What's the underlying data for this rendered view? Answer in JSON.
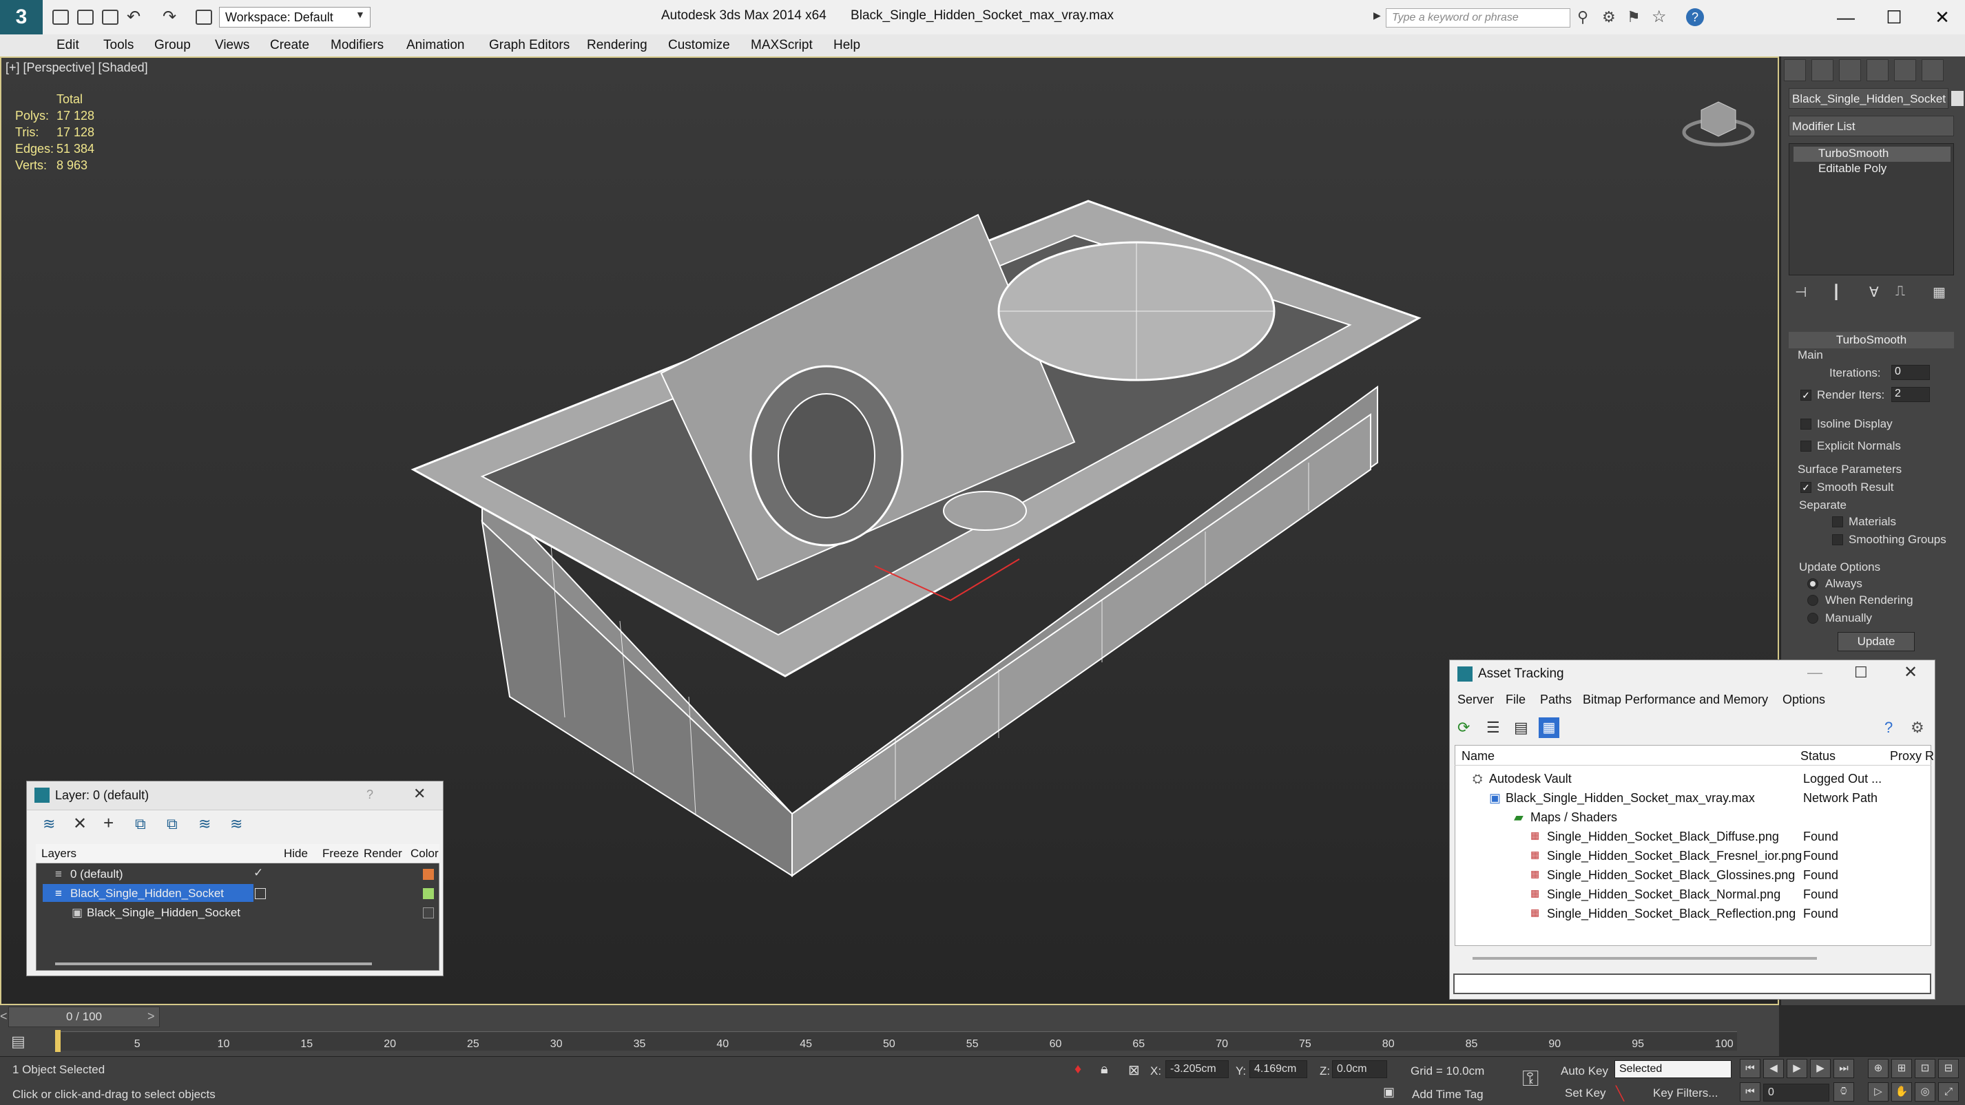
{
  "app": {
    "title": "Autodesk 3ds Max  2014 x64",
    "file_name": "Black_Single_Hidden_Socket_max_vray.max",
    "workspace": "Workspace: Default",
    "search_placeholder": "Type a keyword or phrase"
  },
  "menu": [
    "Edit",
    "Tools",
    "Group",
    "Views",
    "Create",
    "Modifiers",
    "Animation",
    "Graph Editors",
    "Rendering",
    "Customize",
    "MAXScript",
    "Help"
  ],
  "viewport": {
    "label": "[+] [Perspective] [Shaded]",
    "stats": {
      "header": "Total",
      "polys_label": "Polys:",
      "polys": "17 128",
      "tris_label": "Tris:",
      "tris": "17 128",
      "edges_label": "Edges:",
      "edges": "51 384",
      "verts_label": "Verts:",
      "verts": "8 963"
    }
  },
  "command_panel": {
    "object_name": "Black_Single_Hidden_Socket",
    "modifier_list": "Modifier List",
    "stack": [
      "TurboSmooth",
      "Editable Poly"
    ],
    "rollout": "TurboSmooth",
    "main_label": "Main",
    "iterations_label": "Iterations:",
    "iterations": "0",
    "render_iters_label": "Render Iters:",
    "render_iters": "2",
    "isoline": "Isoline Display",
    "explicit_normals": "Explicit Normals",
    "surface_params": "Surface Parameters",
    "smooth_result": "Smooth Result",
    "separate": "Separate",
    "materials": "Materials",
    "smoothing_groups": "Smoothing Groups",
    "update_options": "Update Options",
    "always": "Always",
    "when_rendering": "When Rendering",
    "manually": "Manually",
    "update_btn": "Update"
  },
  "layer_dialog": {
    "title": "Layer: 0 (default)",
    "columns": [
      "Layers",
      "Hide",
      "Freeze",
      "Render",
      "Color"
    ],
    "rows": [
      {
        "name": "0 (default)",
        "color": "#e07a3a"
      },
      {
        "name": "Black_Single_Hidden_Socket",
        "color": "#9ed86a"
      },
      {
        "name": "Black_Single_Hidden_Socket",
        "color": "#444444"
      }
    ]
  },
  "asset_dialog": {
    "title": "Asset Tracking",
    "menu": [
      "Server",
      "File",
      "Paths",
      "Bitmap Performance and Memory",
      "Options"
    ],
    "columns": [
      "Name",
      "Status",
      "Proxy R"
    ],
    "rows": [
      {
        "name": "Autodesk Vault",
        "status": "Logged Out ..."
      },
      {
        "name": "Black_Single_Hidden_Socket_max_vray.max",
        "status": "Network Path"
      },
      {
        "name": "Maps / Shaders",
        "status": ""
      },
      {
        "name": "Single_Hidden_Socket_Black_Diffuse.png",
        "status": "Found"
      },
      {
        "name": "Single_Hidden_Socket_Black_Fresnel_ior.png",
        "status": "Found"
      },
      {
        "name": "Single_Hidden_Socket_Black_Glossines.png",
        "status": "Found"
      },
      {
        "name": "Single_Hidden_Socket_Black_Normal.png",
        "status": "Found"
      },
      {
        "name": "Single_Hidden_Socket_Black_Reflection.png",
        "status": "Found"
      }
    ]
  },
  "timeline": {
    "slider": "0 / 100",
    "ticks": [
      "5",
      "10",
      "15",
      "20",
      "25",
      "30",
      "35",
      "40",
      "45",
      "50",
      "55",
      "60",
      "65",
      "70",
      "75",
      "80",
      "85",
      "90",
      "95",
      "100"
    ]
  },
  "status": {
    "selected": "1 Object Selected",
    "prompt": "Click or click-and-drag to select objects",
    "x_label": "X:",
    "x": "-3.205cm",
    "y_label": "Y:",
    "y": "4.169cm",
    "z_label": "Z:",
    "z": "0.0cm",
    "grid": "Grid = 10.0cm",
    "add_time_tag": "Add Time Tag",
    "auto_key": "Auto Key",
    "set_key": "Set Key",
    "selected_dropdown": "Selected",
    "key_filters": "Key Filters...",
    "frame": "0"
  }
}
